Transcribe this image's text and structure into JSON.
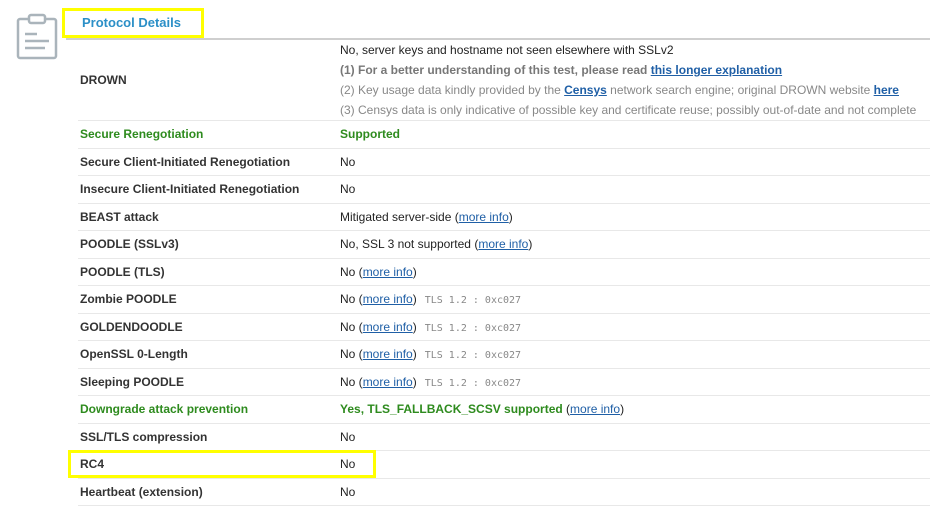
{
  "section": {
    "title": "Protocol Details",
    "icon": "clipboard-icon"
  },
  "drown": {
    "label": "DROWN",
    "value": "No, server keys and hostname not seen elsewhere with SSLv2",
    "note1_prefix": "(1) For a better understanding of this test, please read ",
    "note1_link": "this longer explanation",
    "note2_prefix": "(2) Key usage data kindly provided by the ",
    "note2_link": "Censys",
    "note2_mid": " network search engine; original DROWN website ",
    "note2_link2": "here",
    "note3": "(3) Censys data is only indicative of possible key and certificate reuse; possibly out-of-date and not complete"
  },
  "rows": [
    {
      "label": "Secure Renegotiation",
      "value": "Supported",
      "green": true
    },
    {
      "label": "Secure Client-Initiated Renegotiation",
      "value": "No"
    },
    {
      "label": "Insecure Client-Initiated Renegotiation",
      "value": "No"
    },
    {
      "label": "BEAST attack",
      "value": "Mitigated server-side",
      "link": "more info"
    },
    {
      "label": "POODLE (SSLv3)",
      "value": "No, SSL 3 not supported",
      "link": "more info"
    },
    {
      "label": "POODLE (TLS)",
      "value": "No",
      "link": "more info"
    },
    {
      "label": "Zombie POODLE",
      "value": "No",
      "link": "more info",
      "detail": "TLS 1.2 : 0xc027"
    },
    {
      "label": "GOLDENDOODLE",
      "value": "No",
      "link": "more info",
      "detail": "TLS 1.2 : 0xc027"
    },
    {
      "label": "OpenSSL 0-Length",
      "value": "No",
      "link": "more info",
      "detail": "TLS 1.2 : 0xc027"
    },
    {
      "label": "Sleeping POODLE",
      "value": "No",
      "link": "more info",
      "detail": "TLS 1.2 : 0xc027"
    },
    {
      "label": "Downgrade attack prevention",
      "value": "Yes, TLS_FALLBACK_SCSV supported",
      "link": "more info",
      "green": true
    },
    {
      "label": "SSL/TLS compression",
      "value": "No"
    },
    {
      "label": "RC4",
      "value": "No"
    },
    {
      "label": "Heartbeat (extension)",
      "value": "No"
    }
  ],
  "colors": {
    "title": "#2b8fc7",
    "good": "#2e8b1e",
    "link": "#1f5fa6",
    "highlight": "#ffff00"
  }
}
